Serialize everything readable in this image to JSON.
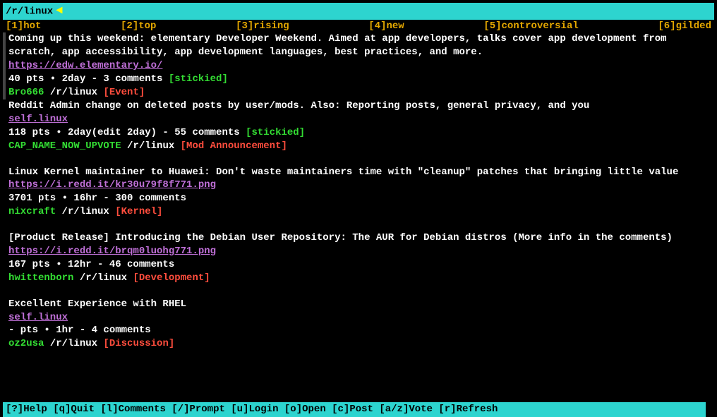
{
  "header": {
    "path": "/r/linux"
  },
  "tabs": {
    "t1": "[1]hot",
    "t2": "[2]top",
    "t3": "[3]rising",
    "t4": "[4]new",
    "t5": "[5]controversial",
    "t6": "[6]gilded"
  },
  "posts": [
    {
      "title": "Coming up this weekend: elementary Developer Weekend. Aimed at app developers, talks cover app development from scratch, app accessibility, app development languages, best practices, and more.",
      "url": "https://edw.elementary.io/",
      "meta": "40 pts • 2day - 3 comments ",
      "stickied": "[stickied]",
      "author": "Bro666",
      "sub": " /r/linux ",
      "flair": "[Event]"
    },
    {
      "title": "Reddit Admin change on deleted posts by user/mods. Also: Reporting posts, general privacy, and you",
      "url": "self.linux",
      "meta": "118 pts • 2day(edit 2day) - 55 comments ",
      "stickied": "[stickied]",
      "author": "CAP_NAME_NOW_UPVOTE",
      "sub": " /r/linux ",
      "flair": "[Mod Announcement]"
    },
    {
      "title": "Linux Kernel maintainer to Huawei: Don't waste maintainers time with \"cleanup\" patches that bringing little value",
      "url": "https://i.redd.it/kr30u79f8f771.png",
      "meta": "3701 pts • 16hr - 300 comments",
      "stickied": "",
      "author": "nixcraft",
      "sub": " /r/linux ",
      "flair": "[Kernel]"
    },
    {
      "title": "[Product Release] Introducing the Debian User Repository: The AUR for Debian distros (More info in the comments)",
      "url": "https://i.redd.it/brqm0luohg771.png",
      "meta": "167 pts • 12hr - 46 comments",
      "stickied": "",
      "author": "hwittenborn",
      "sub": " /r/linux ",
      "flair": "[Development]"
    },
    {
      "title": "Excellent Experience with RHEL",
      "url": "self.linux",
      "meta": "- pts • 1hr - 4 comments",
      "stickied": "",
      "author": "oz2usa",
      "sub": " /r/linux ",
      "flair": "[Discussion]"
    }
  ],
  "footer": {
    "help": "[?]Help ",
    "quit": "[q]Quit ",
    "comments": "[l]Comments ",
    "prompt": "[/]Prompt ",
    "login": "[u]Login ",
    "open": "[o]Open ",
    "post": "[c]Post ",
    "vote": "[a/z]Vote ",
    "refresh": "[r]Refresh"
  }
}
